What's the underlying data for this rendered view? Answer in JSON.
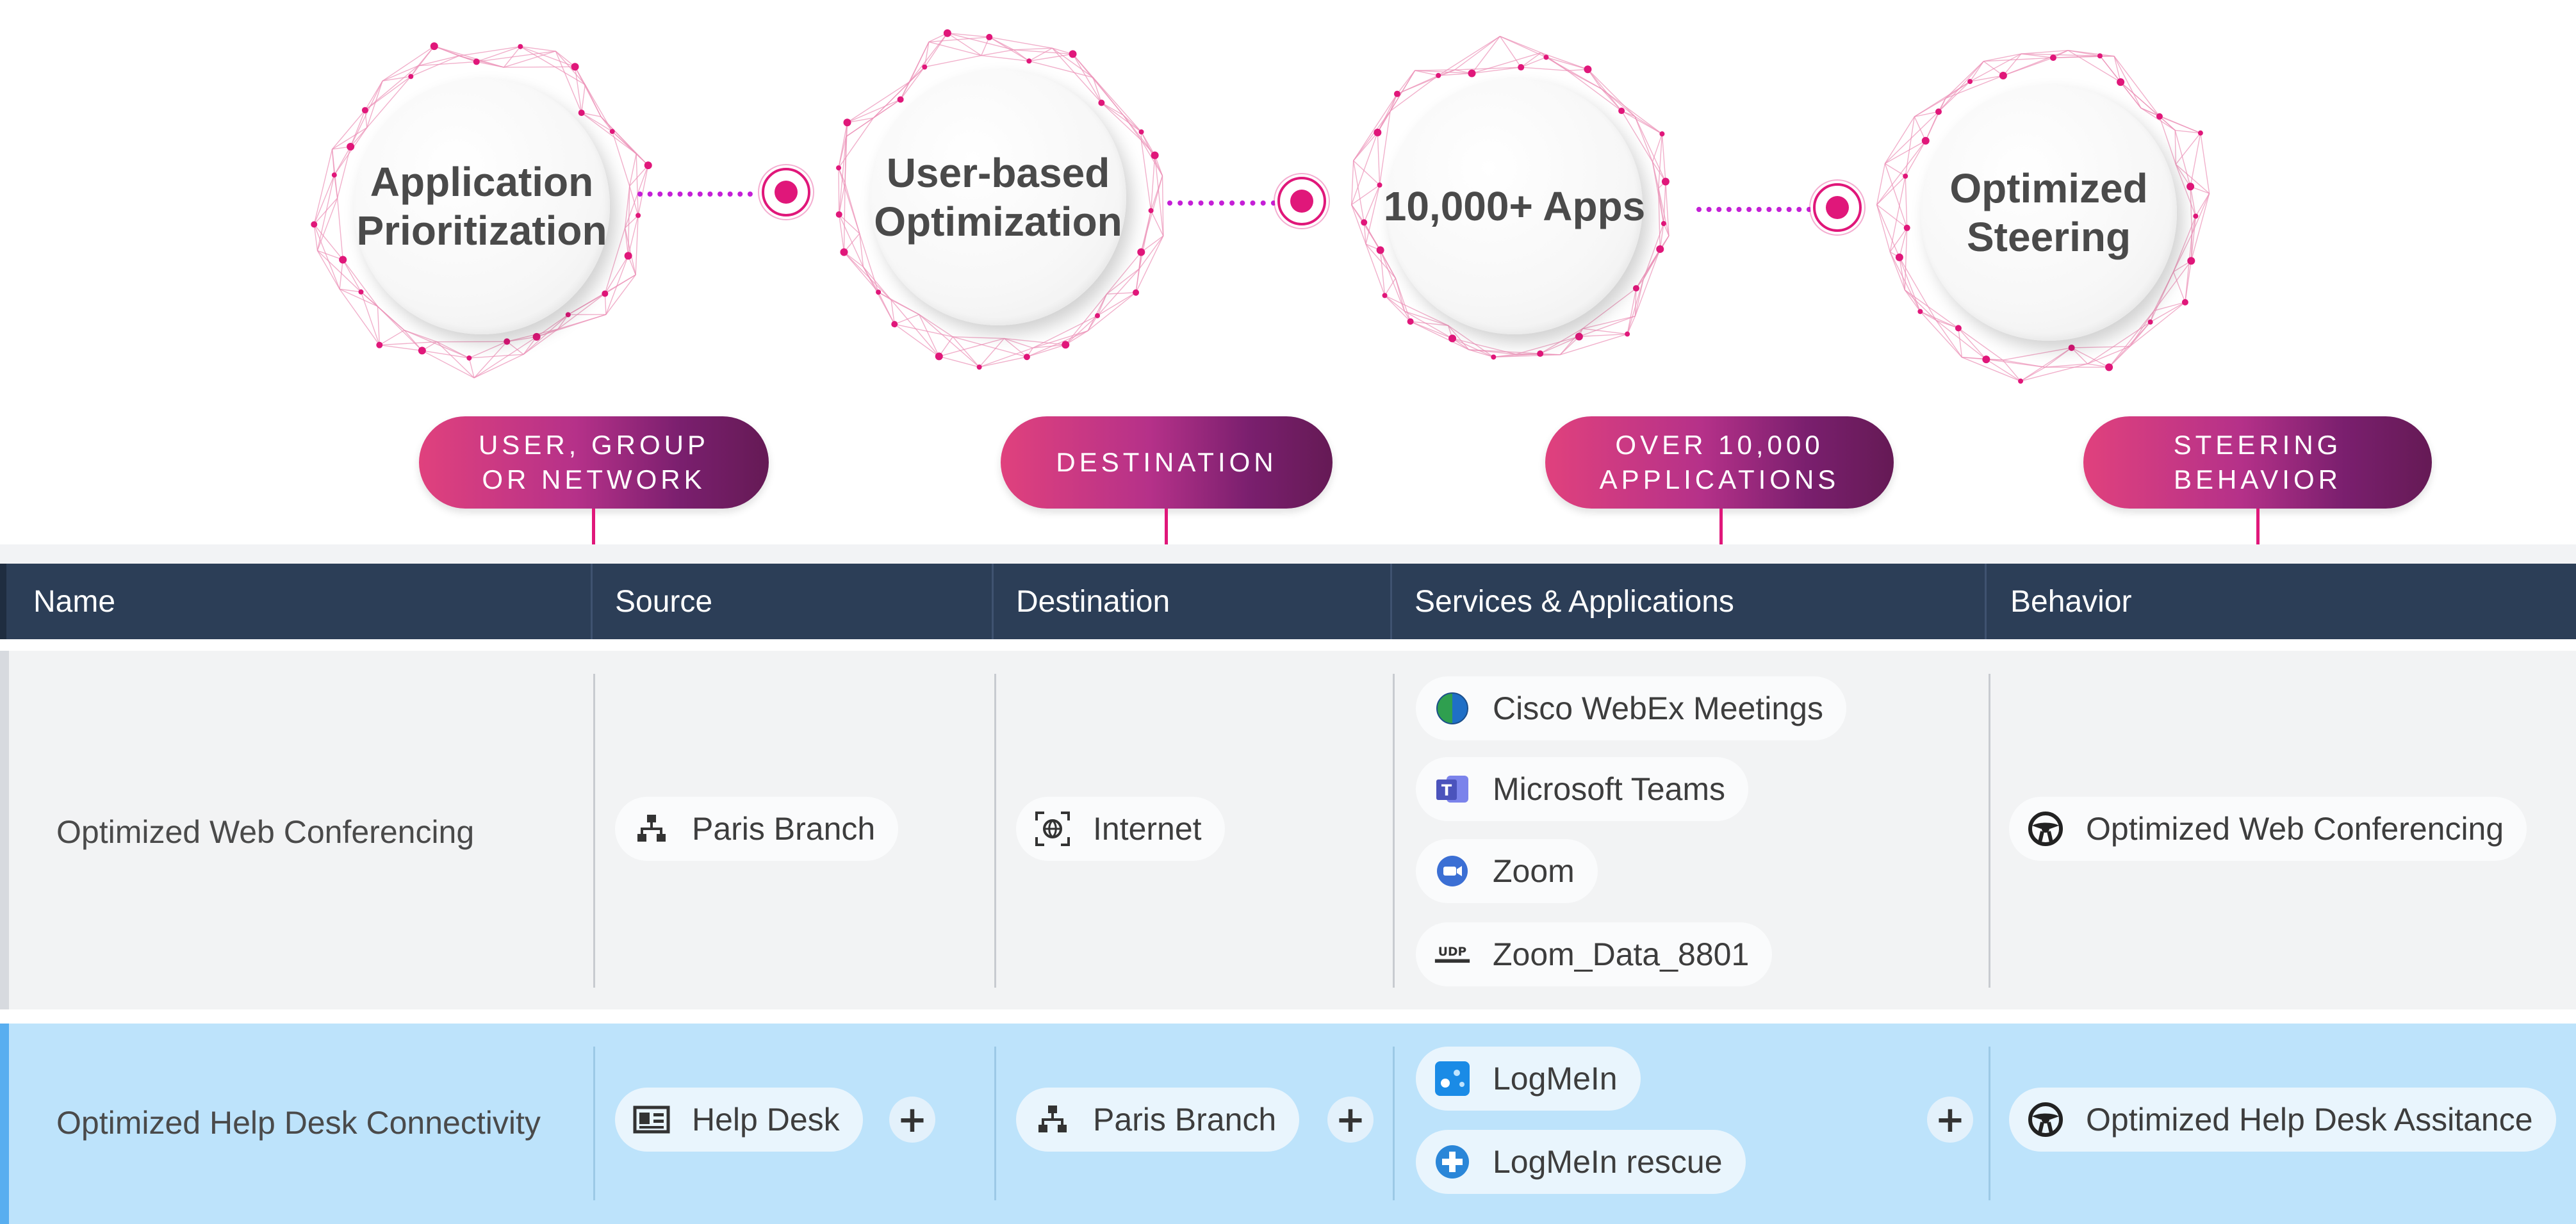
{
  "features": [
    {
      "title": "Application Prioritization"
    },
    {
      "title": "User-based Optimization"
    },
    {
      "title": "10,000+ Apps"
    },
    {
      "title": "Optimized Steering"
    }
  ],
  "tags": [
    {
      "text": "USER, GROUP OR NETWORK"
    },
    {
      "text": "DESTINATION"
    },
    {
      "text": "OVER 10,000 APPLICATIONS"
    },
    {
      "text": "STEERING BEHAVIOR"
    }
  ],
  "table": {
    "columns": [
      "Name",
      "Source",
      "Destination",
      "Services & Applications",
      "Behavior"
    ],
    "rows": [
      {
        "name": "Optimized Web Conferencing",
        "source": "Paris Branch",
        "destination": "Internet",
        "services": [
          "Cisco WebEx Meetings",
          "Microsoft Teams",
          "Zoom",
          "Zoom_Data_8801"
        ],
        "behavior": "Optimized Web Conferencing"
      },
      {
        "name": "Optimized Help Desk Connectivity",
        "source": "Help Desk",
        "destination": "Paris Branch",
        "services": [
          "LogMeIn",
          "LogMeIn rescue"
        ],
        "behavior": "Optimized Help Desk Assitance"
      }
    ]
  },
  "icons": {
    "add": "+",
    "udp": "UDP"
  },
  "colors": {
    "accent_pink": "#e0177a",
    "dotted_purple": "#c41fd6",
    "header_bg": "#2c3e57",
    "row_highlight": "#bde3fb"
  }
}
